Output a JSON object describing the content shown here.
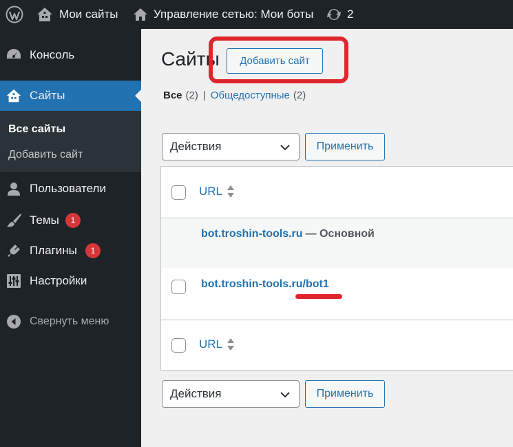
{
  "adminbar": {
    "my_sites": "Мои сайты",
    "network": "Управление сетью: Мои боты",
    "updates_count": "2"
  },
  "sidebar": {
    "console": "Консоль",
    "sites": "Сайты",
    "submenu": {
      "all_sites": "Все сайты",
      "add_site": "Добавить сайт"
    },
    "users": "Пользователи",
    "themes": "Темы",
    "themes_badge": "1",
    "plugins": "Плагины",
    "plugins_badge": "1",
    "settings": "Настройки",
    "collapse": "Свернуть меню"
  },
  "main": {
    "title": "Сайты",
    "add_site_button": "Добавить сайт",
    "filters": {
      "all_label": "Все",
      "all_count": "(2)",
      "public_label": "Общедоступные",
      "public_count": "(2)",
      "separator": "|"
    },
    "bulk_actions": "Действия",
    "apply_button": "Применить",
    "table": {
      "column_url": "URL",
      "rows": [
        {
          "url": "bot.troshin-tools.ru",
          "suffix": "— Основной"
        },
        {
          "url": "bot.troshin-tools.ru/bot1"
        }
      ]
    }
  },
  "colors": {
    "accent": "#2271b1",
    "sidebar_bg": "#1d2327",
    "highlight": "#e0262d",
    "badge": "#d63638"
  }
}
